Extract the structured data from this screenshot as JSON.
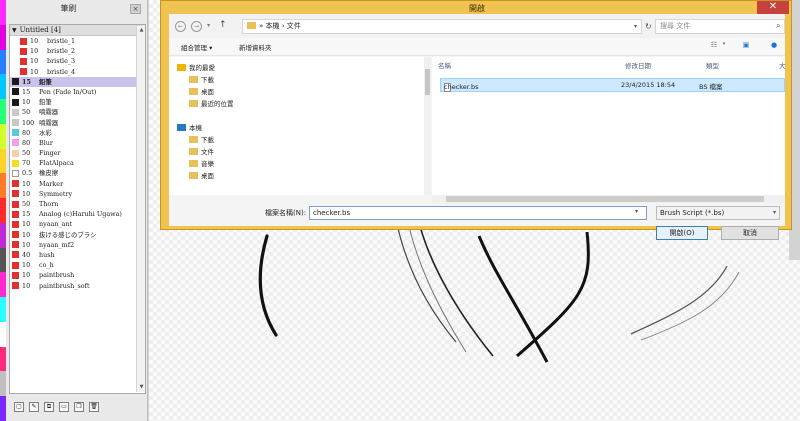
{
  "colors": {
    "dialog_frame": "#f0c24f",
    "dialog_close": "#c7413f",
    "selected_brush_row": "#c9c3ec",
    "selected_file_row": "#cde8ff",
    "strip": [
      "#ff2aff",
      "#e000e0",
      "#2a7dff",
      "#00c8ff",
      "#2aff7a",
      "#d0ff2a",
      "#ffd42a",
      "#ff7a2a",
      "#ff2a2a",
      "#c02ad6",
      "#555555",
      "#ff2ad0",
      "#2affff",
      "#ffffff",
      "#ff2a7a",
      "#c0c0c0",
      "#7a2aff"
    ]
  },
  "brush_panel": {
    "title": "筆刷",
    "close_label": "×",
    "header_label": "Untitled [4]",
    "brushes": [
      {
        "size": "10",
        "name": "bristle_1",
        "color": "#e0302f",
        "indent": true,
        "selected": false
      },
      {
        "size": "10",
        "name": "bristle_2",
        "color": "#e0302f",
        "indent": true,
        "selected": false
      },
      {
        "size": "10",
        "name": "bristle_3",
        "color": "#e0302f",
        "indent": true,
        "selected": false
      },
      {
        "size": "10",
        "name": "bristle_4",
        "color": "#e0302f",
        "indent": true,
        "selected": false
      },
      {
        "size": "15",
        "name": "鉛筆",
        "color": "#1a1a1a",
        "indent": false,
        "selected": true
      },
      {
        "size": "15",
        "name": "Pen (Fade In/Out)",
        "color": "#1a1a1a",
        "indent": false,
        "selected": false
      },
      {
        "size": "10",
        "name": "鉛筆",
        "color": "#1a1a1a",
        "indent": false,
        "selected": false
      },
      {
        "size": "50",
        "name": "噴霧器",
        "color": "#c8c8c8",
        "indent": false,
        "selected": false
      },
      {
        "size": "100",
        "name": "噴霧器",
        "color": "#c8c8c8",
        "indent": false,
        "selected": false
      },
      {
        "size": "80",
        "name": "水彩",
        "color": "#5fc8d8",
        "indent": false,
        "selected": false
      },
      {
        "size": "80",
        "name": "Blur",
        "color": "#f0a0f0",
        "indent": false,
        "selected": false
      },
      {
        "size": "50",
        "name": "Finger",
        "color": "#f8d0a8",
        "indent": false,
        "selected": false
      },
      {
        "size": "70",
        "name": "FlatAlpaca",
        "color": "#f0e020",
        "indent": false,
        "selected": false
      },
      {
        "size": "0.5",
        "name": "橡皮擦",
        "color": "#ffffff",
        "indent": false,
        "selected": false
      },
      {
        "size": "10",
        "name": "Marker",
        "color": "#e0302f",
        "indent": false,
        "selected": false
      },
      {
        "size": "10",
        "name": "Symmetry",
        "color": "#e0302f",
        "indent": false,
        "selected": false
      },
      {
        "size": "50",
        "name": "Thorn",
        "color": "#e0302f",
        "indent": false,
        "selected": false
      },
      {
        "size": "15",
        "name": "Analog (c)Haruhi Ugawa)",
        "color": "#e0302f",
        "indent": false,
        "selected": false
      },
      {
        "size": "10",
        "name": "nyaan_ant",
        "color": "#e0302f",
        "indent": false,
        "selected": false
      },
      {
        "size": "10",
        "name": "抜ける感じのブラシ",
        "color": "#e0302f",
        "indent": false,
        "selected": false
      },
      {
        "size": "10",
        "name": "nyaan_mf2",
        "color": "#e0302f",
        "indent": false,
        "selected": false
      },
      {
        "size": "40",
        "name": "hush",
        "color": "#e0302f",
        "indent": false,
        "selected": false
      },
      {
        "size": "10",
        "name": "co_h",
        "color": "#e0302f",
        "indent": false,
        "selected": false
      },
      {
        "size": "10",
        "name": "paintbrush",
        "color": "#e0302f",
        "indent": false,
        "selected": false
      },
      {
        "size": "10",
        "name": "paintbrush_soft",
        "color": "#e0302f",
        "indent": false,
        "selected": false
      }
    ],
    "footer_icons": [
      "new-brush-icon",
      "edit-brush-icon",
      "copy-brush-icon",
      "folder-icon",
      "duplicate-icon",
      "delete-icon"
    ]
  },
  "dialog": {
    "title": "開啟",
    "close_label": "✕",
    "back_label": "←",
    "forward_label": "→",
    "up_label": "↑",
    "address_path": "» 本機 › 文件",
    "search_placeholder": "搜尋 文件",
    "organize_label": "組合管理 ▾",
    "new_folder_label": "新增資料夾",
    "nav_items": [
      {
        "label": "我的最愛",
        "icon": "star-icon",
        "expanded": true
      },
      {
        "label": "下載",
        "icon": "download-folder-icon"
      },
      {
        "label": "桌面",
        "icon": "desktop-folder-icon"
      },
      {
        "label": "最近的位置",
        "icon": "recent-places-icon"
      },
      {
        "label": "本機",
        "icon": "computer-icon"
      },
      {
        "label": "下載",
        "icon": "download-folder-icon"
      },
      {
        "label": "文件",
        "icon": "documents-folder-icon"
      },
      {
        "label": "音樂",
        "icon": "music-folder-icon"
      },
      {
        "label": "桌面",
        "icon": "desktop-folder-icon"
      }
    ],
    "columns": [
      "名稱",
      "修改日期",
      "類型",
      "大"
    ],
    "files": [
      {
        "name": "checker.bs",
        "modified": "23/4/2015 18:54",
        "type": "BS 檔案"
      }
    ],
    "filename_label": "檔案名稱(N):",
    "filename_value": "checker.bs",
    "filetype_value": "Brush Script (*.bs)",
    "open_label": "開啟(O)",
    "cancel_label": "取消"
  }
}
